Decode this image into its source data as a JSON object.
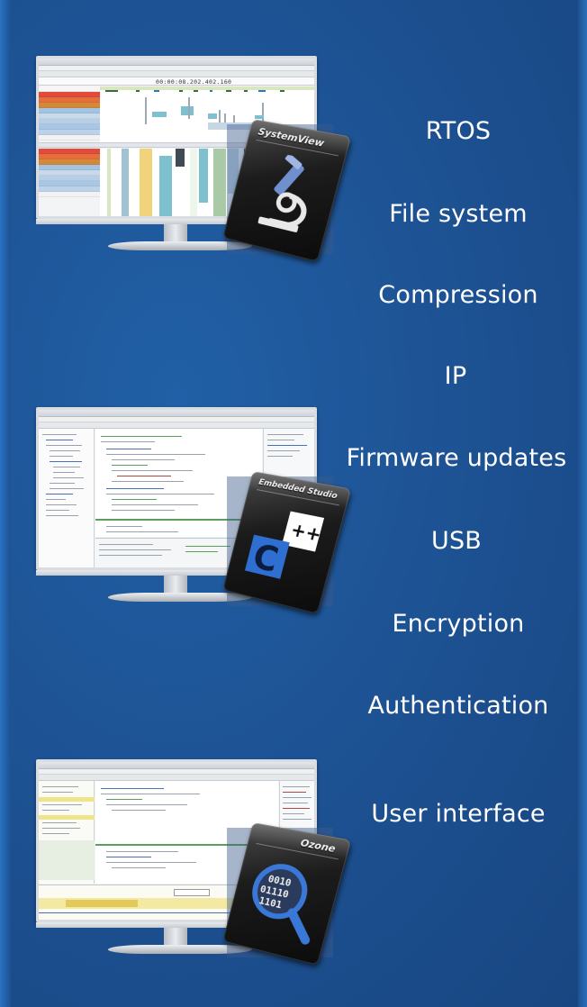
{
  "colors": {
    "background": "#1d5191",
    "text": "#ffffff"
  },
  "products": [
    {
      "name": "SystemView",
      "icon": "microscope-icon",
      "timestamp": "00:00:08.202.402.160"
    },
    {
      "name": "Embedded Studio",
      "icon": "c-plus-plus-icon"
    },
    {
      "name": "Ozone",
      "icon": "binary-magnifier-icon",
      "binary_lines": [
        "0010",
        "01110",
        "1101"
      ]
    }
  ],
  "features": [
    "RTOS",
    "File system",
    "Compression",
    "IP",
    "Firmware updates",
    "USB",
    "Encryption",
    "Authentication",
    "User interface"
  ]
}
